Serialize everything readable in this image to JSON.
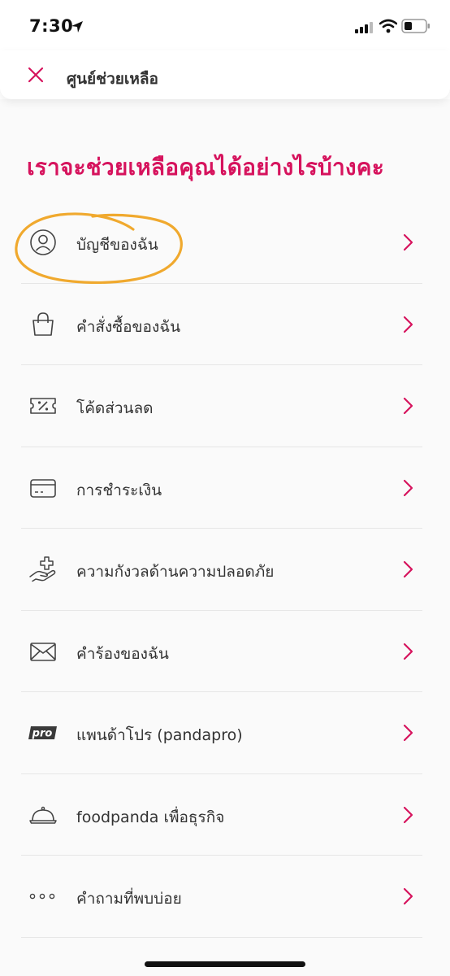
{
  "status_bar": {
    "time": "7:30",
    "icons": [
      "location-arrow-icon",
      "cellular-signal-icon",
      "wifi-icon",
      "battery-icon"
    ]
  },
  "header": {
    "title": "ศูนย์ช่วยเหลือ",
    "close_icon": "close-icon"
  },
  "main": {
    "heading": "เราจะช่วยเหลือคุณได้อย่างไรบ้างคะ",
    "items": [
      {
        "label": "บัญชีของฉัน",
        "icon": "user-circle-icon"
      },
      {
        "label": "คำสั่งซื้อของฉัน",
        "icon": "shopping-bag-icon"
      },
      {
        "label": "โค้ดส่วนลด",
        "icon": "voucher-icon"
      },
      {
        "label": "การชำระเงิน",
        "icon": "credit-card-icon"
      },
      {
        "label": "ความกังวลด้านความปลอดภัย",
        "icon": "hand-plus-icon"
      },
      {
        "label": "คำร้องของฉัน",
        "icon": "envelope-icon"
      },
      {
        "label": "แพนด้าโปร (pandapro)",
        "icon": "pro-badge-icon",
        "badge_text": "pro"
      },
      {
        "label": "foodpanda เพื่อธุรกิจ",
        "icon": "cloche-icon"
      },
      {
        "label": "คำถามที่พบบ่อย",
        "icon": "more-dots-icon"
      }
    ]
  },
  "colors": {
    "accent": "#d6135d",
    "annotation": "#f0a92e",
    "text": "#333333",
    "divider": "#e6e6e6"
  }
}
